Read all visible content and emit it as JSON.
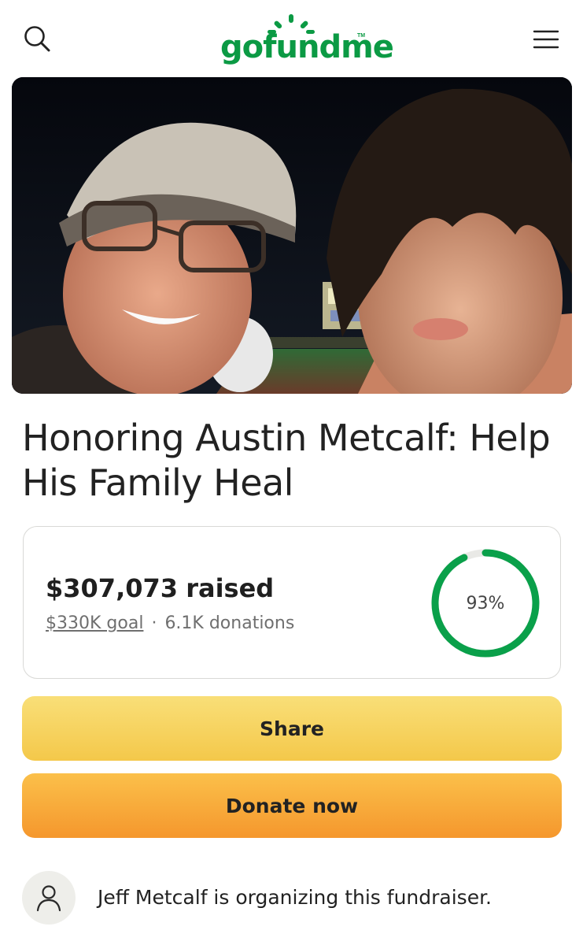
{
  "header": {
    "logo_text": "gofundme",
    "logo_tm": "TM",
    "brand_color": "#0b9a44",
    "search_icon": "search-icon",
    "menu_icon": "hamburger-menu-icon"
  },
  "campaign": {
    "title": "Honoring Austin Metcalf: Help His Family Heal",
    "raised_amount": "$307,073",
    "raised_word": "raised",
    "goal_text": "$330K goal",
    "separator": "·",
    "donations_text": "6.1K donations",
    "progress_percent_label": "93%",
    "progress_fraction": 0.93,
    "progress_color": "#0aa04a",
    "track_color": "#e9e9e6"
  },
  "actions": {
    "share_label": "Share",
    "donate_label": "Donate now"
  },
  "organizer": {
    "text": "Jeff Metcalf is organizing this fundraiser.",
    "avatar_icon": "person-icon"
  }
}
